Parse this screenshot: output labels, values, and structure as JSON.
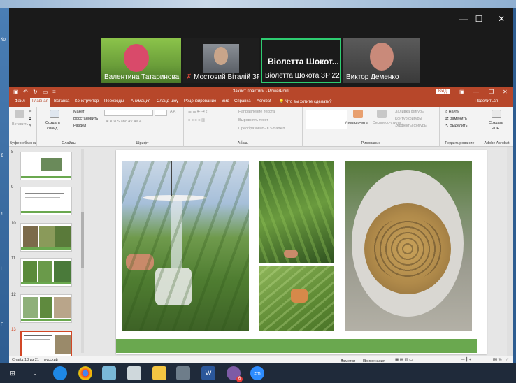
{
  "desktop": {
    "left_icon_labels": [
      "Ко",
      "Д",
      "Л",
      "Н",
      "Г"
    ]
  },
  "zoom": {
    "controls": {
      "minimize": "—",
      "maximize": "☐",
      "close": "✕"
    },
    "participants": [
      {
        "name": "Валентина Татаринова"
      },
      {
        "name": "Мостовий Віталій ЗР..."
      },
      {
        "name": "Віолетта Шокота ЗР 220...",
        "big_label": "Віолетта  Шокот..."
      },
      {
        "name": "Виктор Деменко"
      }
    ]
  },
  "ppt": {
    "title": "Захист практики - PowerPoint",
    "login": "Вхід",
    "menu": [
      "Файл",
      "Главная",
      "Вставка",
      "Конструктор",
      "Переходы",
      "Анимация",
      "Слайд-шоу",
      "Рецензирование",
      "Вид",
      "Справка",
      "Acrobat"
    ],
    "search_placeholder": "Что вы хотите сделать?",
    "share": "Поделиться",
    "ribbon": {
      "clipboard": {
        "paste": "Вставить",
        "label": "Буфер обмена"
      },
      "slides": {
        "create": "Создать",
        "create2": "слайд",
        "layout": "Макет",
        "restore": "Восстановить",
        "section": "Раздел",
        "label": "Слайды"
      },
      "font": {
        "label": "Шрифт"
      },
      "paragraph": {
        "text_dir": "Направление текста",
        "align_text": "Выровнять текст",
        "smartart": "Преобразовать в SmartArt",
        "label": "Абзац"
      },
      "drawing": {
        "arrange": "Упорядочить",
        "quick_styles": "Экспресс-стили",
        "fill": "Заливка фигуры",
        "outline": "Контур фигуры",
        "effects": "Эффекты фигуры",
        "label": "Рисование"
      },
      "editing": {
        "find": "Найти",
        "replace": "Заменить",
        "select": "Выделить",
        "label": "Редактирование"
      },
      "acrobat": {
        "create_pdf": "Создать",
        "create_pdf2": "PDF",
        "label": "Adobe Acrobat"
      }
    },
    "thumbnails": [
      {
        "num": "8"
      },
      {
        "num": "9"
      },
      {
        "num": "10"
      },
      {
        "num": "11"
      },
      {
        "num": "12"
      },
      {
        "num": "13",
        "selected": true
      }
    ],
    "status": {
      "slide": "Слайд 13 из 21",
      "language": "русский",
      "notes": "Заметки",
      "comments": "Примечания",
      "zoom": "86 %"
    }
  },
  "taskbar": {
    "apps": [
      "start",
      "search",
      "edge",
      "chrome",
      "feather",
      "notepad",
      "explorer",
      "remote",
      "word",
      "viber",
      "zoom"
    ],
    "viber_badge": "6",
    "word_letter": "W",
    "zoom_letter": "zm"
  }
}
